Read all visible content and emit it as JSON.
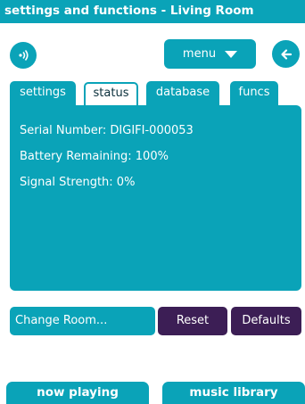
{
  "title": "settings and functions - Living Room",
  "toolbar": {
    "menu_label": "menu"
  },
  "tabs": [
    {
      "label": "settings"
    },
    {
      "label": "status"
    },
    {
      "label": "database"
    },
    {
      "label": "funcs"
    }
  ],
  "status": {
    "serial_number": "Serial Number: DIGIFI-000053",
    "battery": "Battery Remaining: 100%",
    "signal": "Signal Strength: 0%"
  },
  "actions": {
    "change_room": "Change Room...",
    "reset": "Reset",
    "defaults": "Defaults"
  },
  "bottom_nav": {
    "now_playing": "now playing",
    "music_library": "music library"
  },
  "colors": {
    "accent": "#0aa3b8",
    "dark_button": "#3c1e55",
    "text_light": "#ffffff"
  },
  "icons": {
    "speaker": "speaker-icon",
    "menu_caret": "chevron-down-icon",
    "back": "back-arrow-icon"
  }
}
